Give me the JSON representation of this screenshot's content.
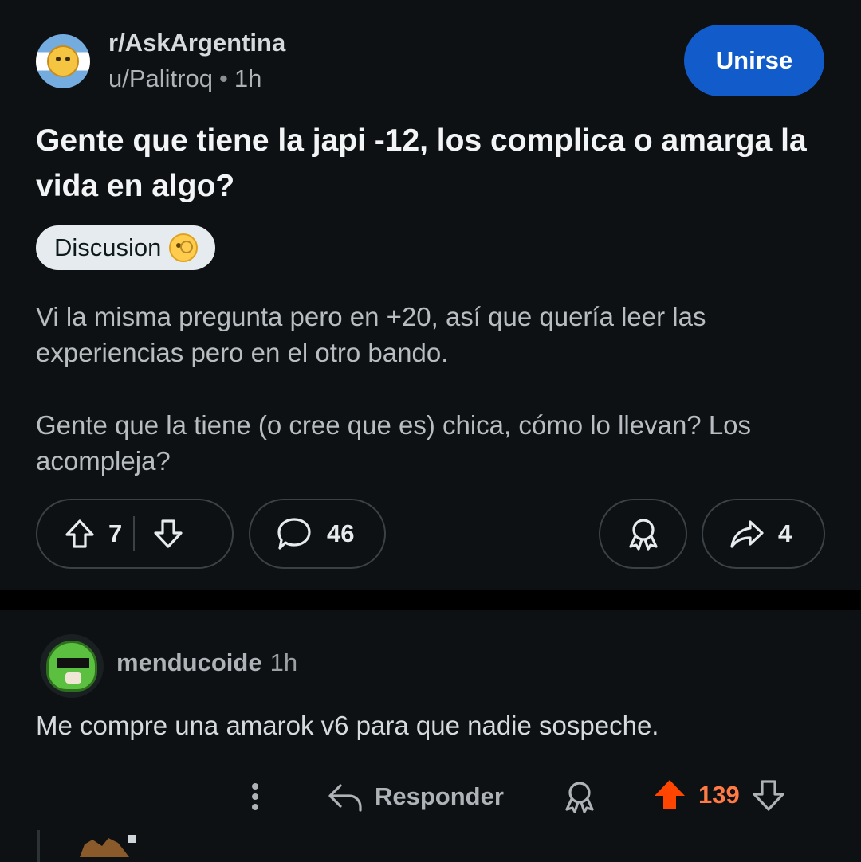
{
  "post": {
    "subreddit": "r/AskArgentina",
    "author": "u/Palitroq",
    "separator": "•",
    "time": "1h",
    "join_label": "Unirse",
    "title": "Gente que tiene la japi -12, los complica o amarga la vida en algo?",
    "flair": "Discusion",
    "body": [
      "Vi la misma pregunta pero en +20, así que quería leer las experiencias pero en el otro bando.",
      "Gente que la tiene (o cree que es) chica, cómo lo llevan? Los acompleja?"
    ],
    "upvotes": "7",
    "comments": "46",
    "shares": "4"
  },
  "comment": {
    "author": "menducoide",
    "time": "1h",
    "text": "Me compre una amarok v6 para que nadie sospeche.",
    "reply_label": "Responder",
    "score": "139"
  },
  "colors": {
    "background": "#0e1113",
    "join_button": "#115bca",
    "upvoted": "#ff4500",
    "score_upvoted": "#ff7a45"
  },
  "icons": [
    "upvote-icon",
    "downvote-icon",
    "comment-icon",
    "award-icon",
    "share-icon",
    "more-icon",
    "reply-icon"
  ]
}
